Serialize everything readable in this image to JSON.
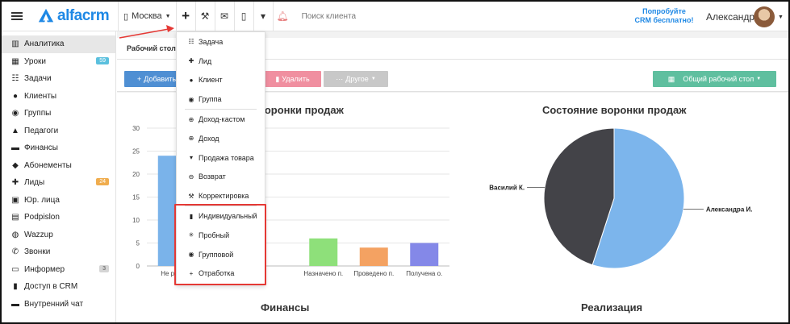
{
  "topbar": {
    "logo_text": "alfacrm",
    "city": "Москва",
    "search_placeholder": "Поиск клиента",
    "try_line1": "Попробуйте",
    "try_line2": "CRM бесплатно!",
    "user_name": "Александра"
  },
  "sidebar": {
    "items": [
      {
        "label": "Аналитика",
        "icon": "chart-icon",
        "glyph": "▥",
        "active": true
      },
      {
        "label": "Уроки",
        "icon": "calendar-icon",
        "glyph": "▦",
        "badge": "59",
        "badge_color": "teal"
      },
      {
        "label": "Задачи",
        "icon": "task-icon",
        "glyph": "☷"
      },
      {
        "label": "Клиенты",
        "icon": "user-icon",
        "glyph": "●"
      },
      {
        "label": "Группы",
        "icon": "group-icon",
        "glyph": "◉"
      },
      {
        "label": "Педагоги",
        "icon": "teacher-icon",
        "glyph": "▲"
      },
      {
        "label": "Финансы",
        "icon": "money-icon",
        "glyph": "▬"
      },
      {
        "label": "Абонементы",
        "icon": "tag-icon",
        "glyph": "◆"
      },
      {
        "label": "Лиды",
        "icon": "lead-icon",
        "glyph": "✚",
        "badge": "24",
        "badge_color": "orange"
      },
      {
        "label": "Юр. лица",
        "icon": "building-icon",
        "glyph": "▣"
      },
      {
        "label": "Podpislon",
        "icon": "doc-icon",
        "glyph": "▤"
      },
      {
        "label": "Wazzup",
        "icon": "whatsapp-icon",
        "glyph": "◍"
      },
      {
        "label": "Звонки",
        "icon": "phone-icon",
        "glyph": "✆"
      },
      {
        "label": "Информер",
        "icon": "informer-icon",
        "glyph": "▭",
        "badge": "3",
        "badge_color": "gray"
      },
      {
        "label": "Доступ в CRM",
        "icon": "lock-icon",
        "glyph": "▮"
      },
      {
        "label": "Внутренний чат",
        "icon": "chat-icon",
        "glyph": "▬"
      }
    ]
  },
  "main": {
    "tab_work": "Рабочий стол",
    "btn_add": "Добавить",
    "btn_delete": "Удалить",
    "btn_other": "Другое",
    "btn_desk": "Общий рабочий стол",
    "left_chart_title": "воронки продаж",
    "right_chart_title": "Состояние воронки продаж",
    "finance_title": "Финансы",
    "realization_title": "Реализация"
  },
  "menu": {
    "items": [
      {
        "label": "Задача",
        "icon": "task-icon",
        "glyph": "☷"
      },
      {
        "label": "Лид",
        "icon": "lead-icon",
        "glyph": "✚"
      },
      {
        "label": "Клиент",
        "icon": "user-icon",
        "glyph": "●"
      },
      {
        "label": "Группа",
        "icon": "group-icon",
        "glyph": "◉"
      },
      {
        "separator": true
      },
      {
        "label": "Доход-кастом",
        "icon": "income-custom-icon",
        "glyph": "⊕"
      },
      {
        "label": "Доход",
        "icon": "income-icon",
        "glyph": "⊕"
      },
      {
        "label": "Продажа товара",
        "icon": "cart-icon",
        "glyph": "▾"
      },
      {
        "label": "Возврат",
        "icon": "refund-icon",
        "glyph": "⊖"
      },
      {
        "label": "Корректировка",
        "icon": "wrench-icon",
        "glyph": "⚒"
      },
      {
        "separator": true
      },
      {
        "label": "Индивидуальный",
        "icon": "individual-icon",
        "glyph": "▮"
      },
      {
        "label": "Пробный",
        "icon": "asterisk-icon",
        "glyph": "✳"
      },
      {
        "label": "Групповой",
        "icon": "group-lesson-icon",
        "glyph": "◉"
      },
      {
        "label": "Отработка",
        "icon": "plus-icon",
        "glyph": "+"
      }
    ]
  },
  "chart_data": [
    {
      "type": "bar",
      "categories": [
        "Не ра...",
        "",
        "",
        "Назначено п.",
        "Проведено п.",
        "Получена о."
      ],
      "values": [
        24,
        0,
        0,
        6,
        4,
        5
      ],
      "colors": [
        "#7ab3ea",
        "#7ab3ea",
        "#7ab3ea",
        "#8ee07a",
        "#f4a262",
        "#8488e8"
      ],
      "title": "",
      "ylim": [
        0,
        30
      ],
      "yticks": [
        0,
        5,
        10,
        15,
        20,
        25,
        30
      ],
      "grid": true
    },
    {
      "type": "pie",
      "title": "Состояние воронки продаж",
      "labels": [
        "Александра И.",
        "Василий К."
      ],
      "values": [
        55,
        45
      ],
      "colors": [
        "#7cb5ec",
        "#434348"
      ]
    }
  ]
}
